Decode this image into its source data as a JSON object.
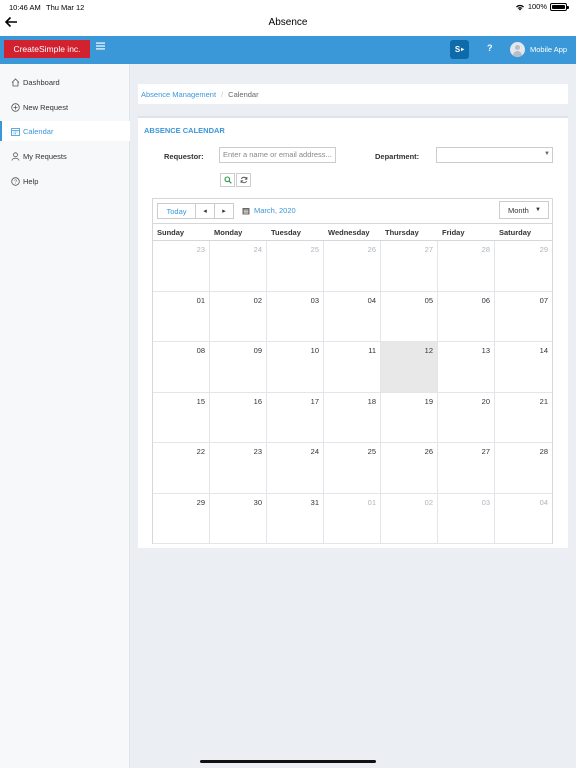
{
  "status_bar": {
    "time": "10:46 AM",
    "date": "Thu Mar 12",
    "battery": "100%"
  },
  "nav": {
    "title": "Absence"
  },
  "header": {
    "logo": "CreateSimple inc.",
    "sp_icon_text": "S",
    "help": "?",
    "user_label": "Mobile App",
    "brand_color": "#3a97d8",
    "logo_color": "#d2212f"
  },
  "sidebar": {
    "items": [
      {
        "label": "Dashboard",
        "icon": "home-icon",
        "active": false
      },
      {
        "label": "New Request",
        "icon": "plus-circle-icon",
        "active": false
      },
      {
        "label": "Calendar",
        "icon": "calendar-icon",
        "active": true
      },
      {
        "label": "My Requests",
        "icon": "user-icon",
        "active": false
      },
      {
        "label": "Help",
        "icon": "question-circle-icon",
        "active": false
      }
    ]
  },
  "breadcrumb": {
    "parent": "Absence Management",
    "separator": "/",
    "current": "Calendar"
  },
  "panel": {
    "title": "ABSENCE CALENDAR",
    "requestor_label": "Requestor:",
    "requestor_placeholder": "Enter a name or email address...",
    "department_label": "Department:",
    "department_value": ""
  },
  "calendar": {
    "today_label": "Today",
    "prev": "◂",
    "next": "▸",
    "month_label": "March, 2020",
    "view_label": "Month",
    "weekdays": [
      "Sunday",
      "Monday",
      "Tuesday",
      "Wednesday",
      "Thursday",
      "Friday",
      "Saturday"
    ],
    "weeks": [
      [
        {
          "d": "23",
          "o": true
        },
        {
          "d": "24",
          "o": true
        },
        {
          "d": "25",
          "o": true
        },
        {
          "d": "26",
          "o": true
        },
        {
          "d": "27",
          "o": true
        },
        {
          "d": "28",
          "o": true
        },
        {
          "d": "29",
          "o": true
        }
      ],
      [
        {
          "d": "01"
        },
        {
          "d": "02"
        },
        {
          "d": "03"
        },
        {
          "d": "04"
        },
        {
          "d": "05"
        },
        {
          "d": "06"
        },
        {
          "d": "07"
        }
      ],
      [
        {
          "d": "08"
        },
        {
          "d": "09"
        },
        {
          "d": "10"
        },
        {
          "d": "11"
        },
        {
          "d": "12",
          "t": true
        },
        {
          "d": "13"
        },
        {
          "d": "14"
        }
      ],
      [
        {
          "d": "15"
        },
        {
          "d": "16"
        },
        {
          "d": "17"
        },
        {
          "d": "18"
        },
        {
          "d": "19"
        },
        {
          "d": "20"
        },
        {
          "d": "21"
        }
      ],
      [
        {
          "d": "22"
        },
        {
          "d": "23"
        },
        {
          "d": "24"
        },
        {
          "d": "25"
        },
        {
          "d": "26"
        },
        {
          "d": "27"
        },
        {
          "d": "28"
        }
      ],
      [
        {
          "d": "29"
        },
        {
          "d": "30"
        },
        {
          "d": "31"
        },
        {
          "d": "01",
          "o": true
        },
        {
          "d": "02",
          "o": true
        },
        {
          "d": "03",
          "o": true
        },
        {
          "d": "04",
          "o": true
        }
      ]
    ]
  }
}
